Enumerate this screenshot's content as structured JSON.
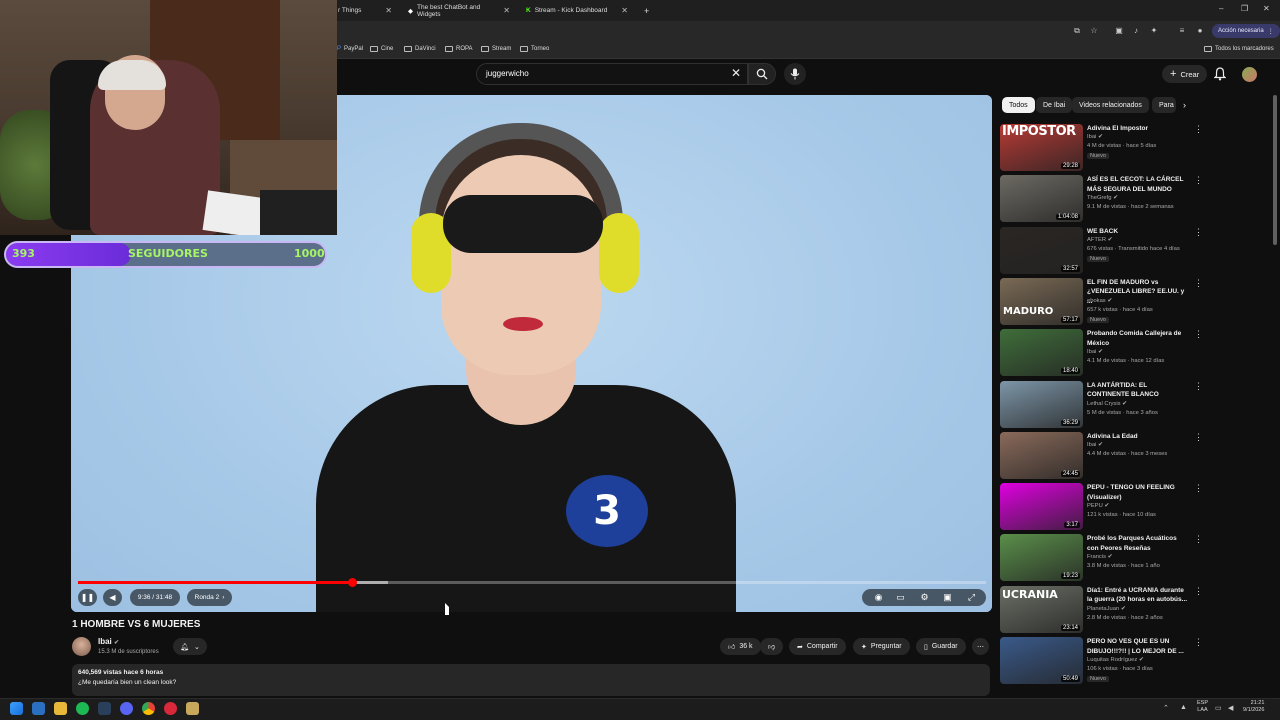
{
  "browser": {
    "tabs": [
      {
        "title": "r Things"
      },
      {
        "title": "The best ChatBot and Widgets"
      },
      {
        "title": "Stream - Kick Dashboard"
      }
    ],
    "new_tab": "+",
    "window_buttons": {
      "minimize": "–",
      "maximize": "❐",
      "close": "✕"
    },
    "action_button": "Acción necesaria",
    "bookmarks": [
      "PayPal",
      "Cine",
      "DaVinci",
      "ROPA",
      "Stream",
      "Torneo"
    ],
    "all_bookmarks": "Todos los marcadores"
  },
  "youtube": {
    "search_value": "juggerwicho",
    "create_label": "Crear",
    "video": {
      "title": "1 HOMBRE VS 6 MUJERES",
      "time": "9:36 / 31:48",
      "chapter": "Ronda 2",
      "progress_fraction": 0.302,
      "badge_number": "3"
    },
    "channel": {
      "name": "Ibai",
      "subscribers": "15.3 M de suscriptores"
    },
    "actions": {
      "likes": "36 k",
      "share": "Compartir",
      "ask": "Preguntar",
      "save": "Guardar"
    },
    "description": {
      "meta": "640,569 vistas  hace 6 horas",
      "text": "¿Me quedaría bien un clean look?"
    },
    "chips": [
      "Todos",
      "De Ibai",
      "Videos relacionados",
      "Para"
    ],
    "recommendations": [
      {
        "title": "Adivina El Impostor",
        "channel": "Ibai",
        "meta": "4 M de vistas · hace 5 días",
        "duration": "29:28",
        "new": "Nuevo",
        "thumb_color": "#b83a35"
      },
      {
        "title": "ASÍ ES EL CECOT: LA CÁRCEL MÁS SEGURA DEL MUNDO",
        "channel": "TheGrefg",
        "meta": "9.1 M de vistas · hace 2 semanas",
        "duration": "1:04:08",
        "new": "",
        "thumb_color": "#6d6a63"
      },
      {
        "title": "WE BACK",
        "channel": "AFTER",
        "meta": "676 vistas · Transmitido hace 4 días",
        "duration": "32:57",
        "new": "Nuevo",
        "thumb_color": "#2a2623"
      },
      {
        "title": "EL FIN DE MADURO vs ¿VENEZUELA LIBRE? EE.UU. y ...",
        "channel": "ebokas",
        "meta": "657 k vistas · hace 4 días",
        "duration": "57:17",
        "new": "Nuevo",
        "thumb_color": "#7a6a55"
      },
      {
        "title": "Probando Comida Callejera de México",
        "channel": "Ibai",
        "meta": "4.1 M de vistas · hace 12 días",
        "duration": "18:40",
        "new": "",
        "thumb_color": "#3f6e3a"
      },
      {
        "title": "LA ANTÁRTIDA: EL CONTINENTE BLANCO",
        "channel": "Lethal Crysis",
        "meta": "5 M de vistas · hace 3 años",
        "duration": "36:29",
        "new": "",
        "thumb_color": "#7d96a8"
      },
      {
        "title": "Adivina La Edad",
        "channel": "Ibai",
        "meta": "4.4 M de vistas · hace 3 meses",
        "duration": "24:45",
        "new": "",
        "thumb_color": "#8a6a5a"
      },
      {
        "title": "PEPU - TENGO UN FEELING (Visualizer)",
        "channel": "PEPU",
        "meta": "121 k vistas · hace 10 días",
        "duration": "3:17",
        "new": "",
        "thumb_color": "#e000e0"
      },
      {
        "title": "Probé los Parques Acuáticos con Peores Reseñas",
        "channel": "Francis",
        "meta": "3.8 M de vistas · hace 1 año",
        "duration": "19:23",
        "new": "",
        "thumb_color": "#5a8f4a"
      },
      {
        "title": "Día1: Entré a UCRANIA durante la guerra (20 horas en autobús...",
        "channel": "PlanetaJuan",
        "meta": "2.8 M de vistas · hace 2 años",
        "duration": "23:14",
        "new": "",
        "thumb_color": "#6b6f65"
      },
      {
        "title": "PERO NO VES QUE ES UN DIBUJO!!!?!! | LO MEJOR DE ...",
        "channel": "Luquitas Rodríguez",
        "meta": "106 k vistas · hace 3 días",
        "duration": "50:49",
        "new": "Nuevo",
        "thumb_color": "#3a5a8a"
      }
    ],
    "thumb_text_impostor": "IMPOSTOR",
    "thumb_text_maduro": "MADURO",
    "thumb_text_ucrania": "UCRANIA"
  },
  "overlay": {
    "follow_start": "393",
    "follow_label": "SEGUIDORES",
    "follow_goal": "1000",
    "follow_fraction": 0.393
  },
  "taskbar": {
    "lang": "ESP\nLAA",
    "time": "21:21",
    "date": "9/1/2026"
  }
}
